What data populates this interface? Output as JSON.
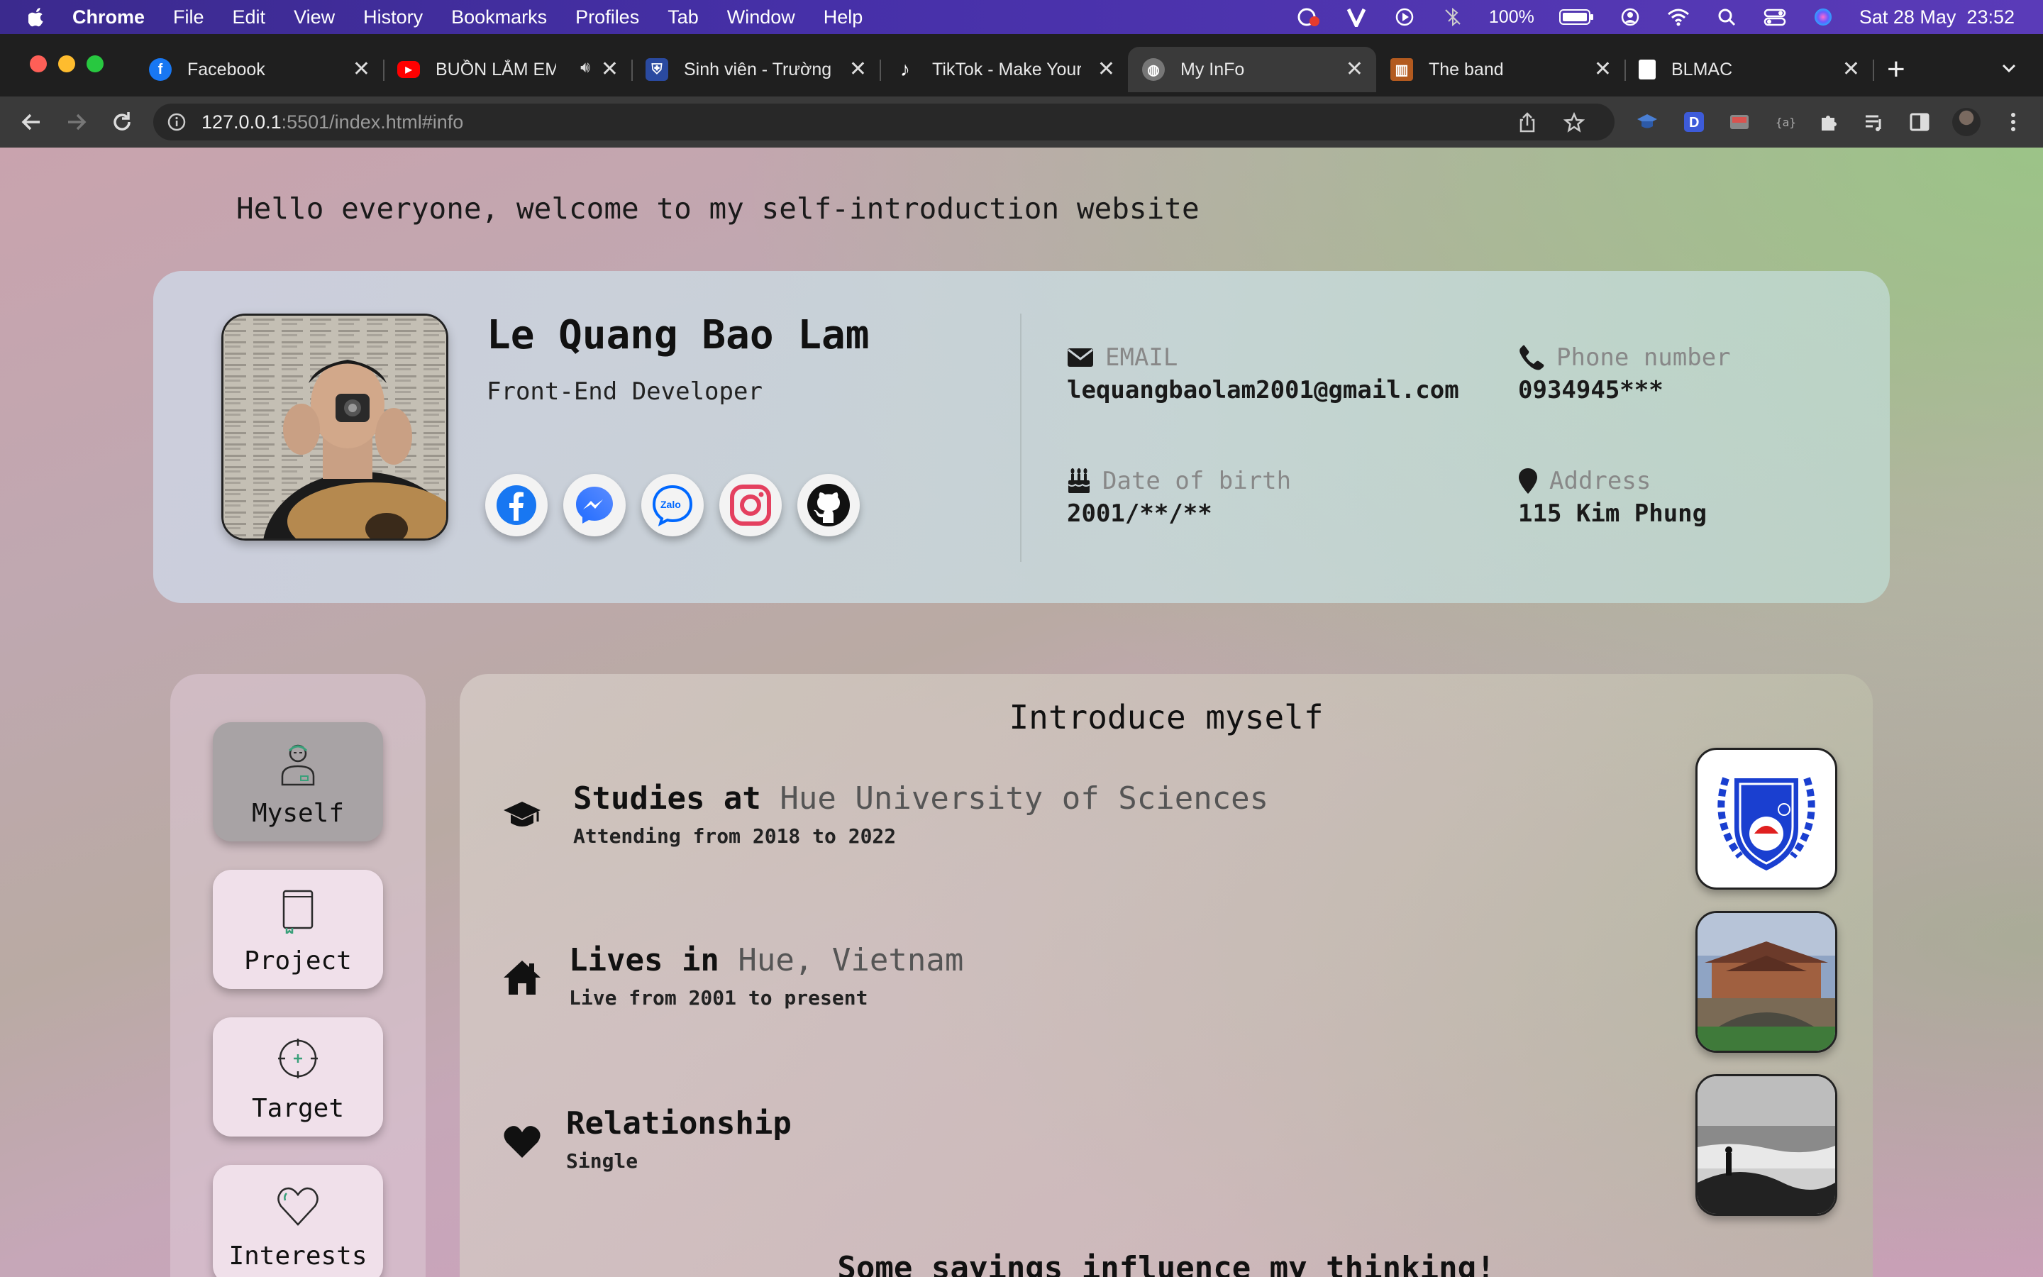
{
  "menubar": {
    "app": "Chrome",
    "items": [
      "File",
      "Edit",
      "View",
      "History",
      "Bookmarks",
      "Profiles",
      "Tab",
      "Window",
      "Help"
    ],
    "battery": "100%",
    "datetime": "Sat 28 May  23:52"
  },
  "tabs": [
    {
      "title": "Facebook",
      "icon": "facebook-icon"
    },
    {
      "title": "BUỒN LẮM EM",
      "icon": "youtube-icon"
    },
    {
      "title": "Sinh viên - Trường Đ",
      "icon": "shield-icon"
    },
    {
      "title": "TikTok - Make Your",
      "icon": "tiktok-icon"
    },
    {
      "title": "My InFo",
      "icon": "globe-icon",
      "active": true
    },
    {
      "title": "The band",
      "icon": "band-icon"
    },
    {
      "title": "BLMAC",
      "icon": "page-icon"
    }
  ],
  "address": {
    "host": "127.0.0.1",
    "rest": ":5501/index.html#info"
  },
  "page": {
    "welcome": "Hello everyone, welcome to my self-introduction website",
    "profile": {
      "name": "Le Quang Bao Lam",
      "role": "Front-End Developer",
      "socials": [
        "facebook",
        "messenger",
        "zalo",
        "instagram",
        "github"
      ],
      "zalo_text": "Zalo"
    },
    "info": {
      "email_label": "EMAIL",
      "email": "lequangbaolam2001@gmail.com",
      "phone_label": "Phone number",
      "phone": "0934945***",
      "dob_label": "Date of birth",
      "dob": "2001/**/**",
      "address_label": "Address",
      "address": "115 Kim Phung"
    },
    "nav": [
      {
        "label": "Myself",
        "icon": "person-icon",
        "active": true
      },
      {
        "label": "Project",
        "icon": "book-icon"
      },
      {
        "label": "Target",
        "icon": "target-icon"
      },
      {
        "label": "Interests",
        "icon": "heart-icon"
      }
    ],
    "intro": {
      "title": "Introduce myself",
      "study_prefix": "Studies at ",
      "study_place": "Hue University of Sciences",
      "study_sub": "Attending from 2018 to 2022",
      "live_prefix": "Lives in ",
      "live_place": "Hue, Vietnam",
      "live_sub": "Live from 2001 to present",
      "rel_title": "Relationship",
      "rel_sub": "Single",
      "sayings": "Some sayings influence my thinking!"
    }
  }
}
